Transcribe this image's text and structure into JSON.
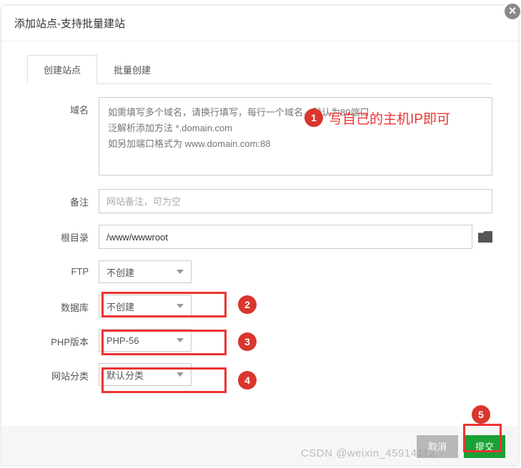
{
  "modal": {
    "title": "添加站点-支持批量建站"
  },
  "tabs": {
    "create": "创建站点",
    "batch": "批量创建"
  },
  "form": {
    "domain_label": "域名",
    "domain_placeholder": "如需填写多个域名，请换行填写，每行一个域名，默认为80端口\n泛解析添加方法 *.domain.com\n如另加端口格式为 www.domain.com:88",
    "remark_label": "备注",
    "remark_placeholder": "网站备注，可为空",
    "root_label": "根目录",
    "root_value": "/www/wwwroot",
    "ftp_label": "FTP",
    "ftp_value": "不创建",
    "db_label": "数据库",
    "db_value": "不创建",
    "php_label": "PHP版本",
    "php_value": "PHP-56",
    "cat_label": "网站分类",
    "cat_value": "默认分类"
  },
  "footer": {
    "cancel": "取消",
    "submit": "提交"
  },
  "annot": {
    "b1": "1",
    "b2": "2",
    "b3": "3",
    "b4": "4",
    "b5": "5",
    "text1": "写自己的主机IP即可"
  },
  "watermark": "CSDN @weixin_45914112"
}
